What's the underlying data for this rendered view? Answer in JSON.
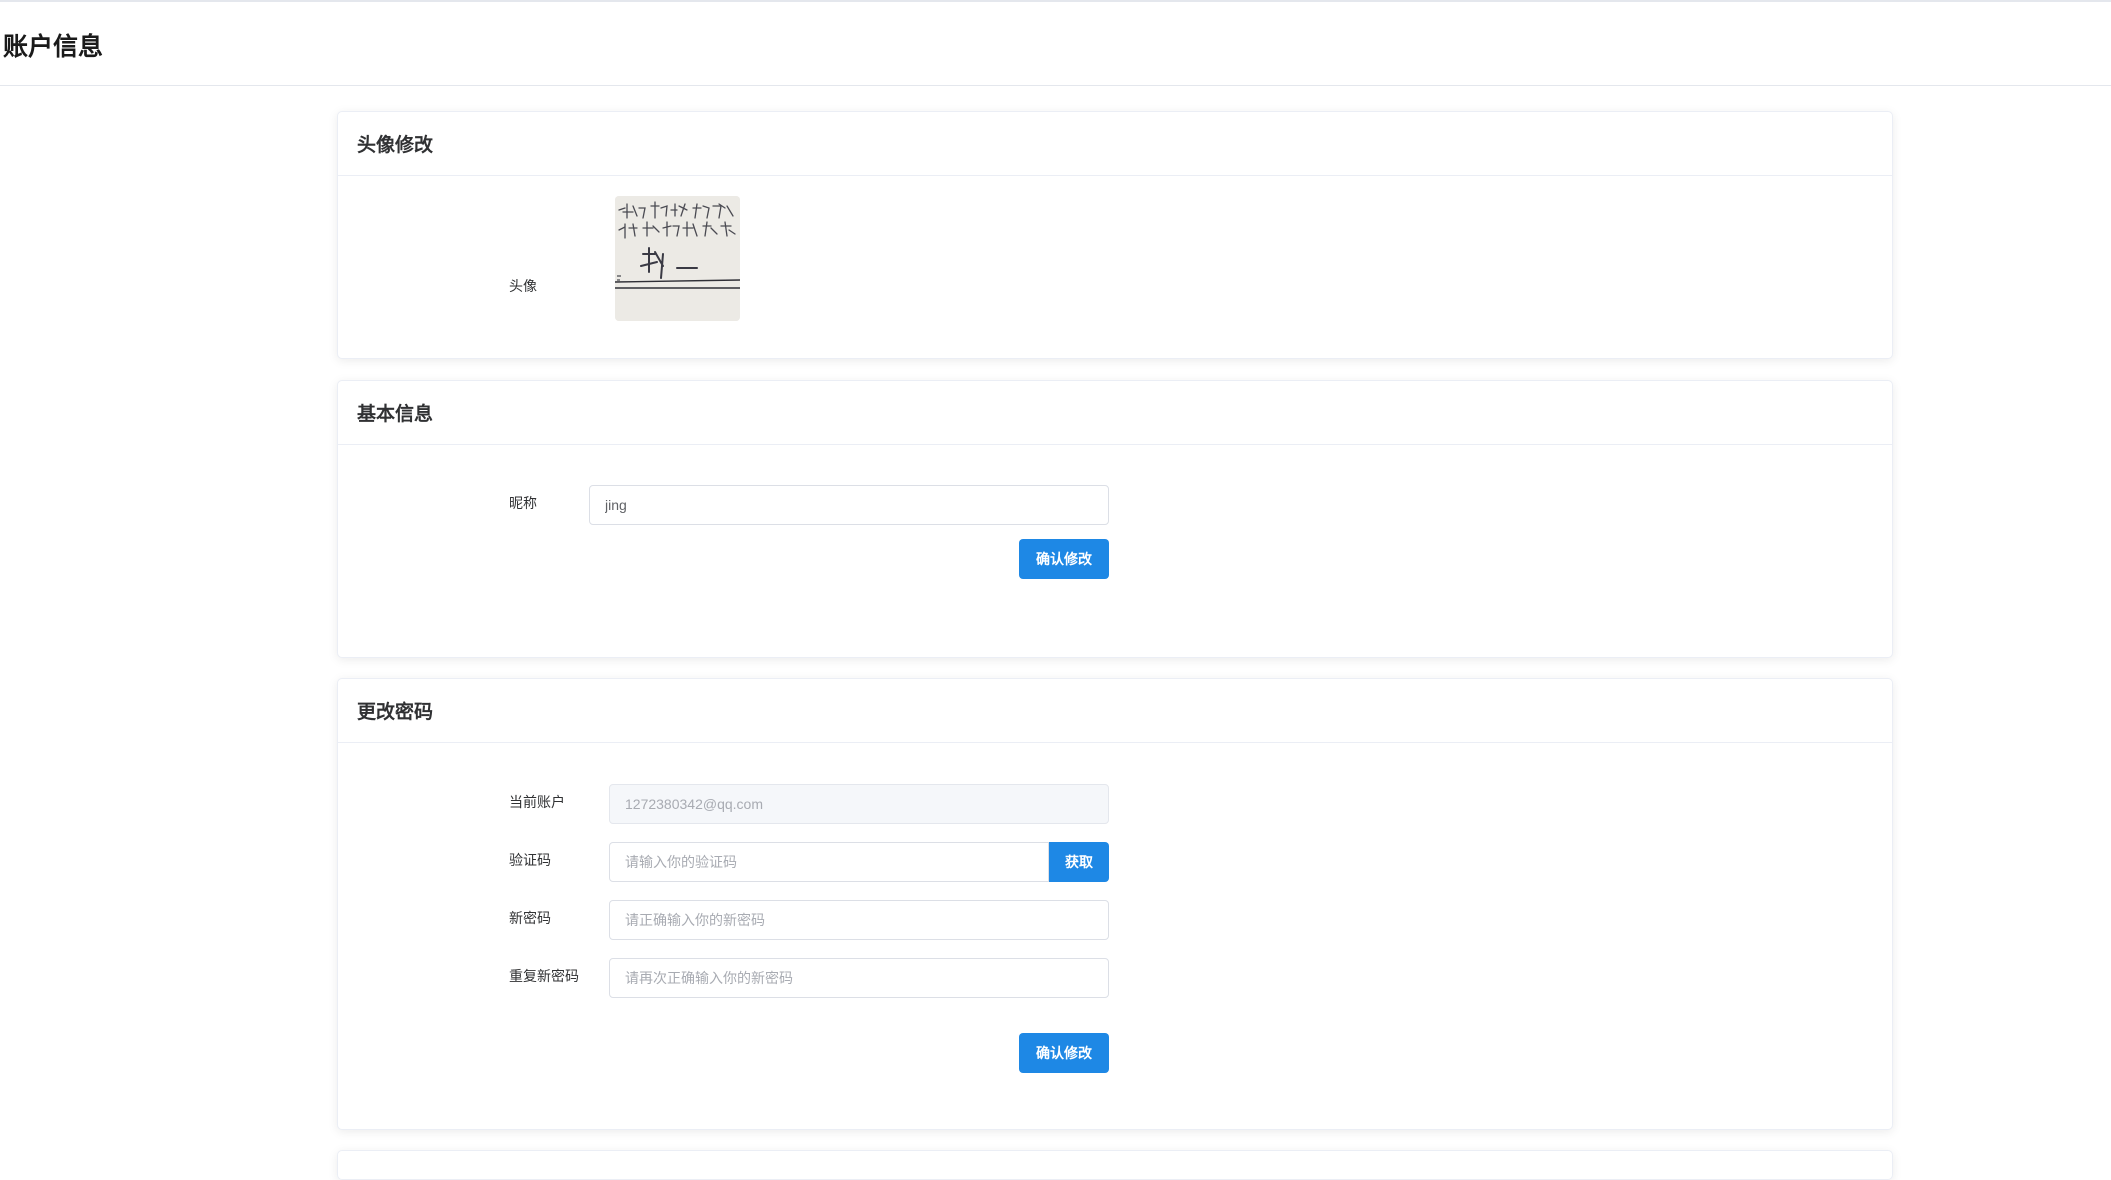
{
  "page": {
    "title": "账户信息"
  },
  "avatar_card": {
    "title": "头像修改",
    "avatar_label": "头像"
  },
  "basic_card": {
    "title": "基本信息",
    "nickname_label": "昵称",
    "nickname_value": "jing",
    "confirm_label": "确认修改"
  },
  "password_card": {
    "title": "更改密码",
    "account_label": "当前账户",
    "account_value": "1272380342@qq.com",
    "code_label": "验证码",
    "code_placeholder": "请输入你的验证码",
    "code_button": "获取",
    "new_pwd_label": "新密码",
    "new_pwd_placeholder": "请正确输入你的新密码",
    "repeat_pwd_label": "重复新密码",
    "repeat_pwd_placeholder": "请再次正确输入你的新密码",
    "confirm_label": "确认修改"
  },
  "colors": {
    "primary": "#1e88e5",
    "border": "#dcdfe6",
    "text": "#303133"
  }
}
